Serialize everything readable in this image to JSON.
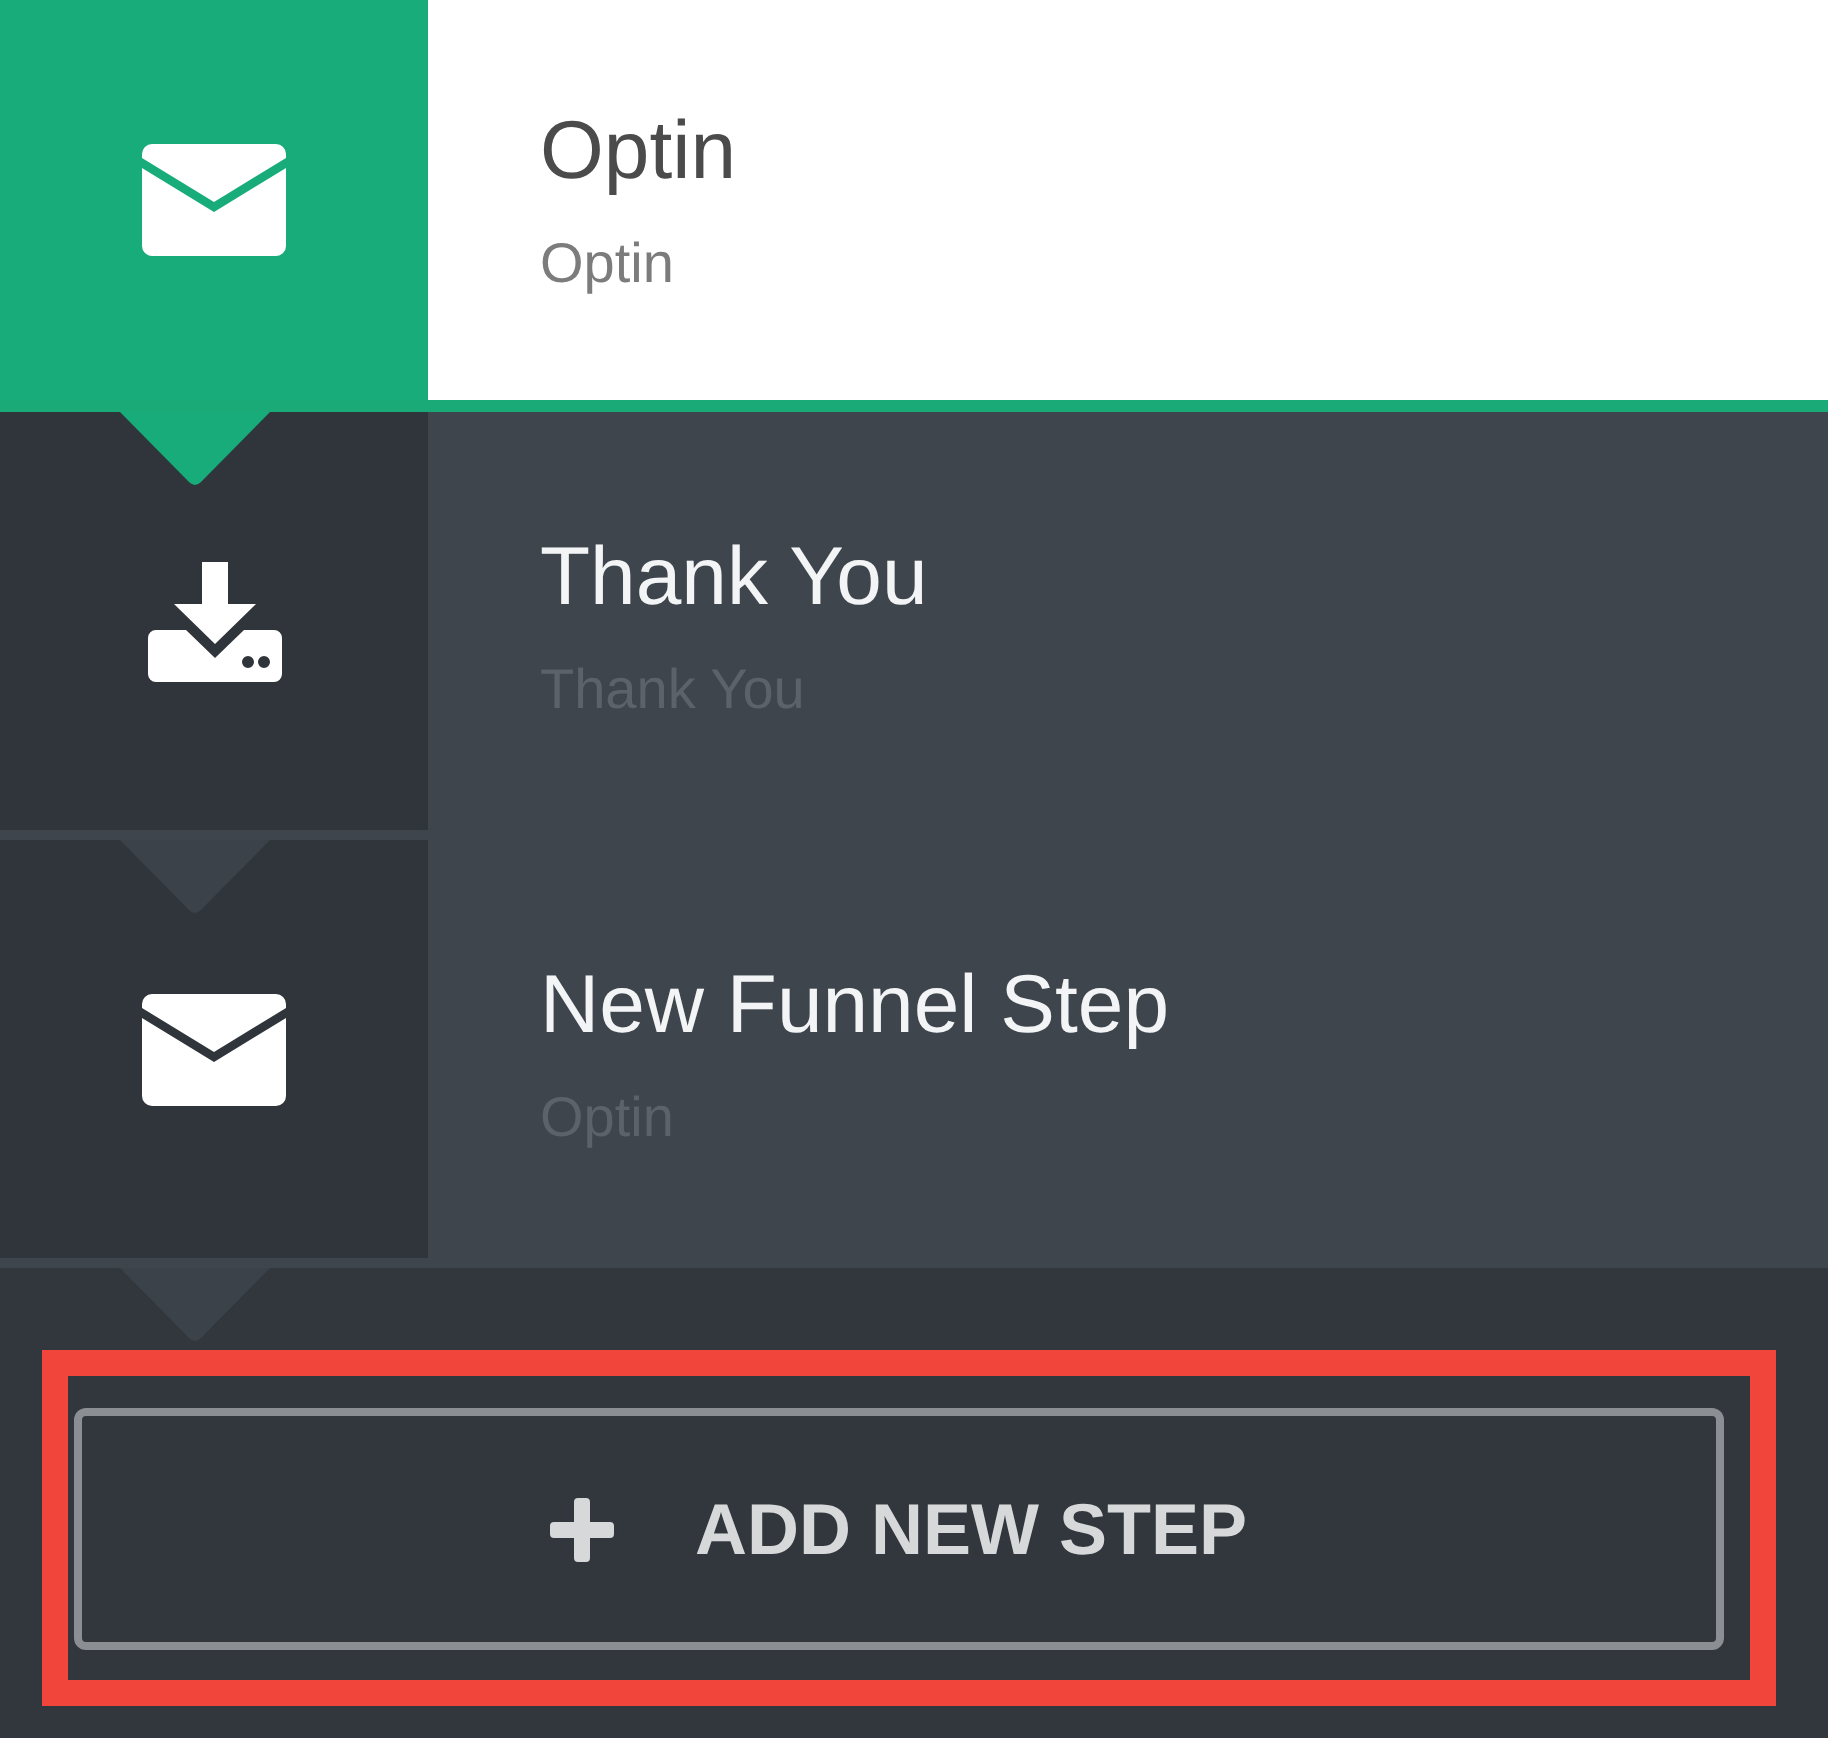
{
  "steps": [
    {
      "title": "Optin",
      "subtitle": "Optin",
      "kind": "optin",
      "selected": true
    },
    {
      "title": "Thank You",
      "subtitle": "Thank You",
      "kind": "thank_you",
      "selected": false
    },
    {
      "title": "New Funnel Step",
      "subtitle": "Optin",
      "kind": "optin",
      "selected": false
    }
  ],
  "add_button": {
    "label": "ADD NEW STEP"
  }
}
